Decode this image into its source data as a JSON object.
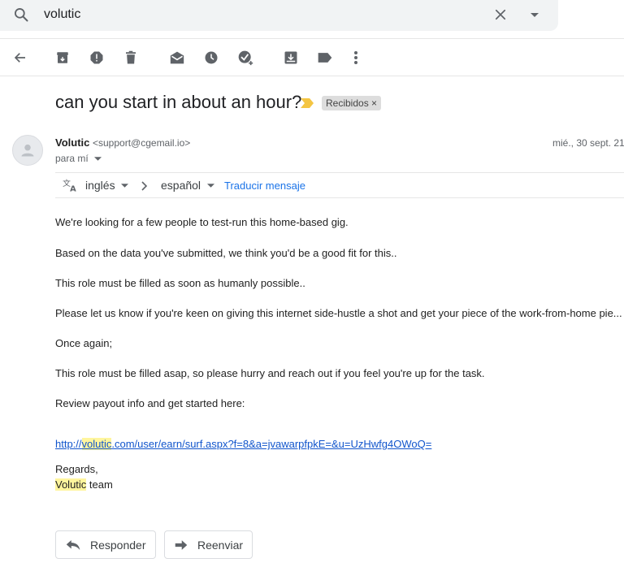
{
  "search": {
    "query": "volutic"
  },
  "message": {
    "subject": "can you start in about an hour?",
    "label": "Recibidos ×",
    "sender_name": "Volutic",
    "sender_email": "<support@cgemail.io>",
    "to": "para mí",
    "date": "mié., 30 sept. 21"
  },
  "translate": {
    "from": "inglés",
    "to": "español",
    "action": "Traducir mensaje"
  },
  "body": {
    "p1": "We're looking for a few people to test-run this home-based gig.",
    "p2": "Based on the data you've submitted, we think you'd be a good fit for this..",
    "p3": "This role must be filled as soon as humanly possible..",
    "p4": "Please let us know if you're keen on giving this internet side-hustle a shot and get your piece of the work-from-home pie...",
    "p5": "Once again;",
    "p6": "This role must be filled asap, so please hurry and reach out if you feel you're up for the task.",
    "p7": "Review payout info and get started here:",
    "link_prefix": "http://",
    "link_highlight": "volutic",
    "link_rest": ".com/user/earn/surf.aspx?f=8&a=jvawarpfpkE=&u=UzHwfg4OWoQ=",
    "regards": "Regards,",
    "team_highlight": "Volutic",
    "team_rest": " team"
  },
  "actions": {
    "reply": "Responder",
    "forward": "Reenviar"
  },
  "colors": {
    "accent": "#1a73e8",
    "highlight": "#fff59d",
    "important": "#f4c542"
  }
}
